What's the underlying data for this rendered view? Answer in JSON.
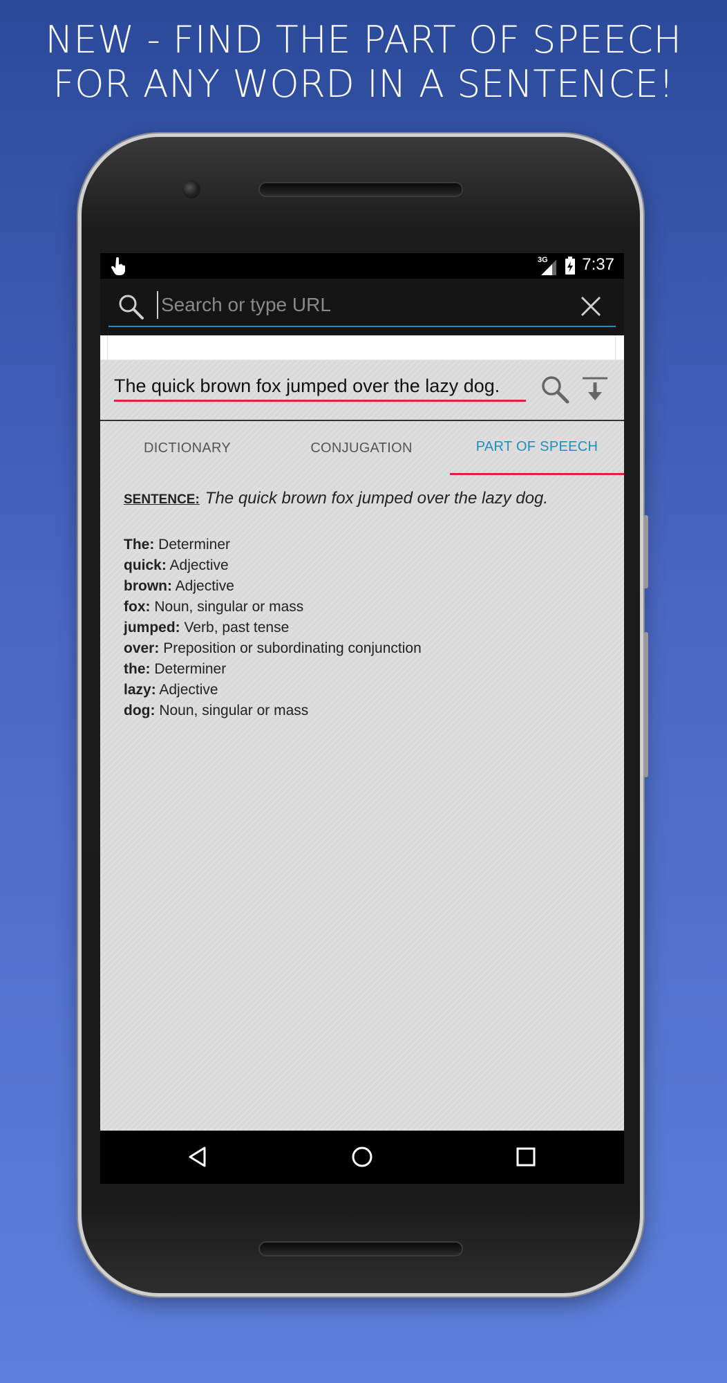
{
  "headline": {
    "line1": "NEW -  FIND THE PART OF SPEECH",
    "line2": "FOR ANY WORD IN A SENTENCE!"
  },
  "status_bar": {
    "network": "3G",
    "time": "7:37"
  },
  "search_bar": {
    "placeholder": "Search or type URL",
    "value": ""
  },
  "sentence_input": {
    "value": "The quick brown fox jumped over the lazy dog."
  },
  "tabs": [
    {
      "label": "DICTIONARY",
      "active": false
    },
    {
      "label": "CONJUGATION",
      "active": false
    },
    {
      "label": "PART OF SPEECH",
      "active": true
    }
  ],
  "part_of_speech": {
    "sentence_label": "SENTENCE:",
    "sentence": "The quick brown fox jumped over the lazy dog.",
    "items": [
      {
        "word": "The:",
        "tag": "Determiner"
      },
      {
        "word": "quick:",
        "tag": "Adjective"
      },
      {
        "word": "brown:",
        "tag": "Adjective"
      },
      {
        "word": "fox:",
        "tag": "Noun, singular or mass"
      },
      {
        "word": "jumped:",
        "tag": "Verb, past tense"
      },
      {
        "word": "over:",
        "tag": "Preposition or subordinating conjunction"
      },
      {
        "word": "the:",
        "tag": "Determiner"
      },
      {
        "word": "lazy:",
        "tag": "Adjective"
      },
      {
        "word": "dog:",
        "tag": "Noun, singular or mass"
      }
    ]
  },
  "colors": {
    "accent_blue": "#1d8fbf",
    "underline_red": "#e0223e"
  }
}
